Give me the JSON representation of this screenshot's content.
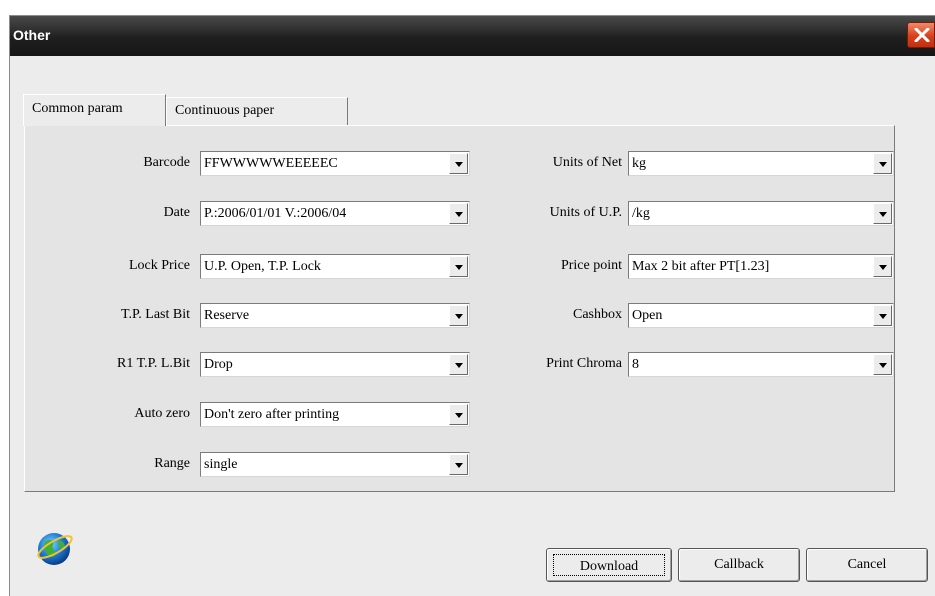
{
  "window": {
    "title": "Other"
  },
  "tabs": [
    {
      "label": "Common param",
      "active": true
    },
    {
      "label": "Continuous paper",
      "active": false
    }
  ],
  "left_fields": [
    {
      "label": "Barcode",
      "value": "FFWWWWWEEEEEC"
    },
    {
      "label": "Date",
      "value": "P.:2006/01/01 V.:2006/04"
    },
    {
      "label": "Lock Price",
      "value": "U.P. Open, T.P. Lock"
    },
    {
      "label": "T.P. Last Bit",
      "value": "Reserve"
    },
    {
      "label": "R1 T.P. L.Bit",
      "value": "Drop"
    },
    {
      "label": "Auto zero",
      "value": "Don't zero after printing"
    },
    {
      "label": "Range",
      "value": "single"
    }
  ],
  "right_fields": [
    {
      "label": "Units of Net",
      "value": "kg"
    },
    {
      "label": "Units of U.P.",
      "value": "/kg"
    },
    {
      "label": "Price point",
      "value": "Max 2 bit after PT[1.23]"
    },
    {
      "label": "Cashbox",
      "value": "Open"
    },
    {
      "label": "Print Chroma",
      "value": "8"
    }
  ],
  "buttons": {
    "download": "Download",
    "callback": "Callback",
    "cancel": "Cancel"
  },
  "icons": {
    "close": "close-icon",
    "logo": "globe-logo-icon"
  },
  "colors": {
    "titlebar": "#1f1f1f",
    "close": "#d8401c",
    "dialog": "#ececec"
  }
}
